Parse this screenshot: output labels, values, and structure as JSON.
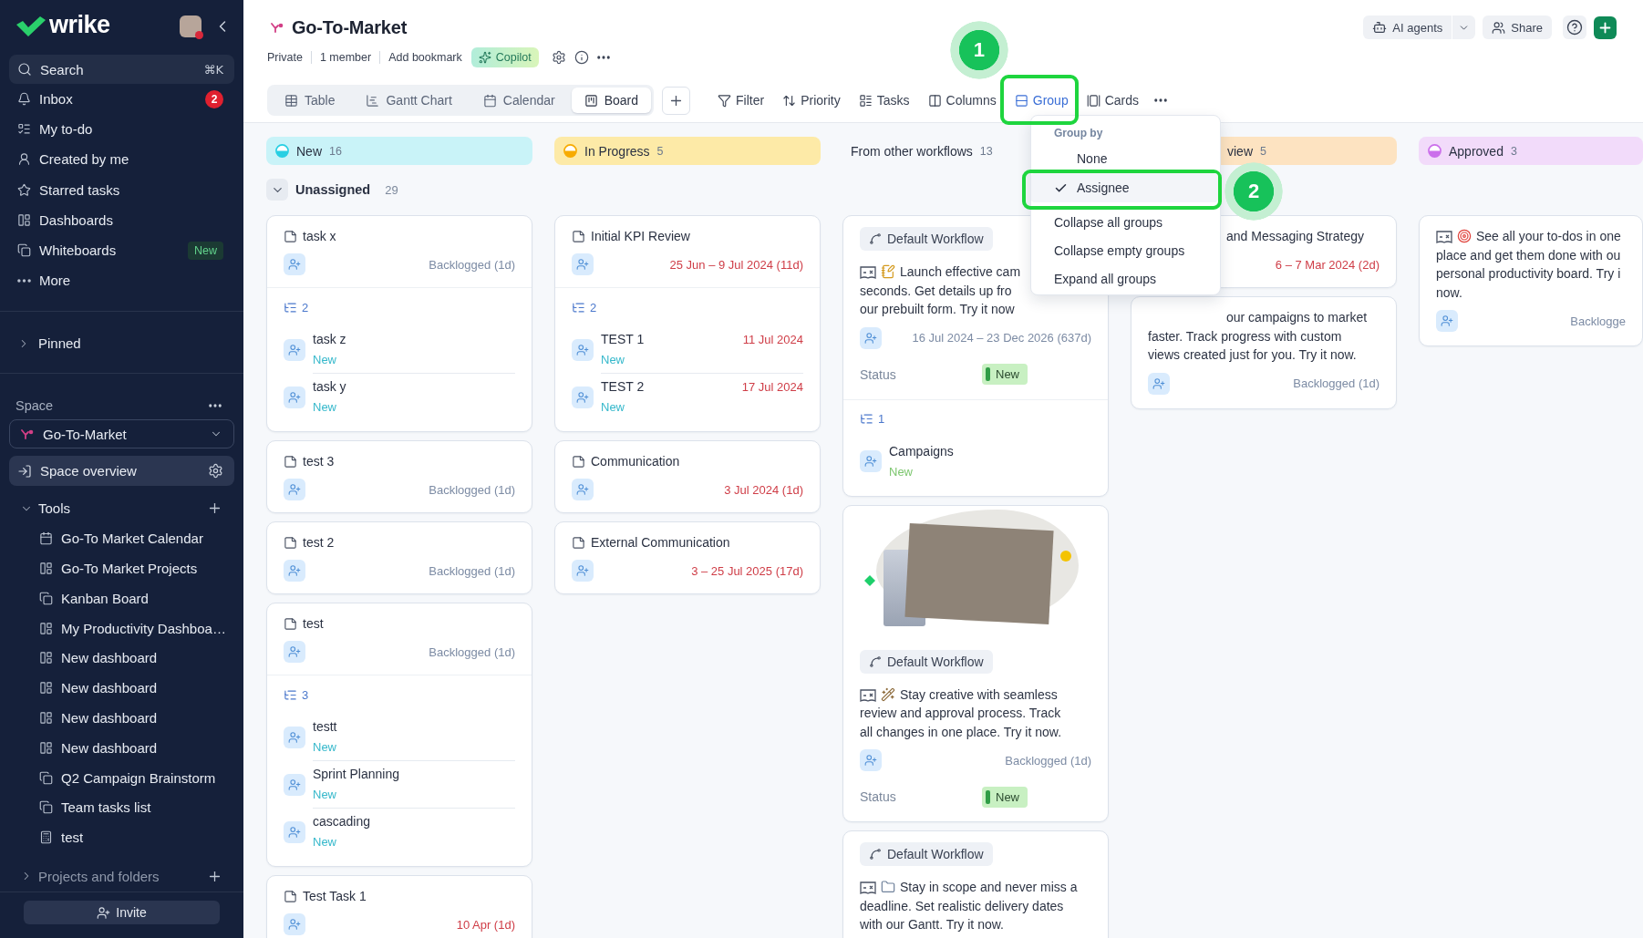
{
  "sidebar": {
    "logo": "wrike",
    "search": {
      "label": "Search",
      "shortcut": "⌘K"
    },
    "nav": [
      {
        "label": "Inbox",
        "kind": "inbox",
        "badge": "2",
        "selected": false
      },
      {
        "label": "My to-do",
        "kind": "todo",
        "selected": false
      },
      {
        "label": "Created by me",
        "kind": "created",
        "selected": false
      },
      {
        "label": "Starred tasks",
        "kind": "starred",
        "selected": false
      },
      {
        "label": "Dashboards",
        "kind": "dashboard",
        "selected": false
      },
      {
        "label": "Whiteboards",
        "kind": "whiteboard",
        "tag": "New",
        "selected": false
      },
      {
        "label": "More",
        "kind": "more",
        "selected": false
      }
    ],
    "pinned": {
      "label": "Pinned",
      "expanded": false
    },
    "space": {
      "label": "Space",
      "selector": "Go-To-Market",
      "overview": {
        "label": "Space overview",
        "selected": true
      }
    },
    "tree": [
      {
        "label": "Tools",
        "expanded": true,
        "children": [
          {
            "label": "Go-To Market Calendar",
            "kind": "calendar",
            "selected": false
          },
          {
            "label": "Go-To Market Projects",
            "kind": "dashboard",
            "selected": false
          },
          {
            "label": "Kanban Board",
            "kind": "whiteboard",
            "selected": false
          },
          {
            "label": "My Productivity Dashboa…",
            "kind": "dashboard",
            "selected": false
          },
          {
            "label": "New dashboard",
            "kind": "dashboard",
            "selected": false
          },
          {
            "label": "New dashboard",
            "kind": "dashboard",
            "selected": false
          },
          {
            "label": "New dashboard",
            "kind": "dashboard",
            "selected": false
          },
          {
            "label": "New dashboard",
            "kind": "dashboard",
            "selected": false
          },
          {
            "label": "Q2 Campaign Brainstorm",
            "kind": "whiteboard",
            "selected": false
          },
          {
            "label": "Team tasks list",
            "kind": "whiteboard",
            "selected": false
          },
          {
            "label": "test",
            "kind": "report",
            "selected": false
          }
        ]
      },
      {
        "label": "Projects and folders",
        "expanded": false
      }
    ],
    "invite": "Invite"
  },
  "header": {
    "title": "Go-To-Market",
    "meta": [
      "Private",
      "1 member",
      "Add bookmark"
    ],
    "copilot": "Copilot",
    "actions": [
      {
        "label": "AI agents",
        "kind": "agents"
      },
      {
        "label": "Share",
        "kind": "share"
      }
    ],
    "views": [
      {
        "label": "Table",
        "kind": "table",
        "selected": false
      },
      {
        "label": "Gantt Chart",
        "kind": "gantt",
        "selected": false
      },
      {
        "label": "Calendar",
        "kind": "calendar",
        "selected": false
      },
      {
        "label": "Board",
        "kind": "board",
        "selected": true
      }
    ],
    "toolbar": [
      {
        "label": "Filter",
        "kind": "filter",
        "active": false
      },
      {
        "label": "Priority",
        "kind": "priority",
        "active": false
      },
      {
        "label": "Tasks",
        "kind": "tasks",
        "active": false
      },
      {
        "label": "Columns",
        "kind": "columns",
        "active": false
      },
      {
        "label": "Group",
        "kind": "group",
        "active": true,
        "annotation": "1"
      },
      {
        "label": "Cards",
        "kind": "cards",
        "active": false
      }
    ]
  },
  "board": {
    "group": {
      "label": "Unassigned",
      "count": "29",
      "expanded": true
    },
    "columns": [
      {
        "label": "New",
        "count": "16",
        "color": "#c9f3f8",
        "cards": [
          {
            "kind": "task",
            "title": "task x",
            "meta": "Backlogged (1d)",
            "overdue": false,
            "subtask_count": "2",
            "subtasks": [
              {
                "name": "task z",
                "status": "New",
                "color": "#35b8cb"
              },
              {
                "name": "task y",
                "status": "New",
                "color": "#35b8cb"
              }
            ]
          },
          {
            "kind": "task",
            "title": "test 3",
            "meta": "Backlogged (1d)",
            "overdue": false
          },
          {
            "kind": "task",
            "title": "test 2",
            "meta": "Backlogged (1d)",
            "overdue": false
          },
          {
            "kind": "task",
            "title": "test",
            "meta": "Backlogged (1d)",
            "overdue": false,
            "subtask_count": "3",
            "subtasks": [
              {
                "name": "testt",
                "status": "New",
                "color": "#35b8cb"
              },
              {
                "name": "Sprint Planning",
                "status": "New",
                "color": "#35b8cb"
              },
              {
                "name": "cascading",
                "status": "New",
                "color": "#35b8cb"
              }
            ]
          },
          {
            "kind": "task",
            "title": "Test Task 1",
            "meta": "10 Apr (1d)",
            "overdue": true
          }
        ]
      },
      {
        "label": "In Progress",
        "count": "5",
        "color": "#fdeaa7",
        "cards": [
          {
            "kind": "task",
            "title": "Initial KPI Review",
            "meta": "25 Jun – 9 Jul 2024 (11d)",
            "overdue": true,
            "subtask_count": "2",
            "subtasks": [
              {
                "name": "TEST 1",
                "status": "New",
                "color": "#35b8cb",
                "date": "11 Jul 2024",
                "overdue": true
              },
              {
                "name": "TEST 2",
                "status": "New",
                "color": "#35b8cb",
                "date": "17 Jul 2024",
                "overdue": true
              }
            ]
          },
          {
            "kind": "task",
            "title": "Communication",
            "meta": "3 Jul 2024 (1d)",
            "overdue": true
          },
          {
            "kind": "task",
            "title": "External Communication",
            "meta": "3 – 25 Jul 2025 (17d)",
            "overdue": true
          }
        ]
      },
      {
        "label": "From other workflows",
        "count": "13",
        "cards": [
          {
            "kind": "template",
            "workflow": "Default Workflow",
            "emoji": {
              "kind": "notepad"
            },
            "text": "Launch effective cam\nseconds. Get details up fro\nour prebuilt form. Try it now",
            "meta": "16 Jul 2024 – 23 Dec 2026 (637d)",
            "overdue": false,
            "status": {
              "label": "Status",
              "value": "New"
            },
            "subtask_count": "1",
            "subtasks": [
              {
                "name": "Campaigns",
                "status": "New",
                "color": "#7cc66e"
              }
            ]
          },
          {
            "kind": "template",
            "image": true,
            "workflow": "Default Workflow",
            "emoji": {
              "kind": "wand"
            },
            "text": "Stay creative with seamless\nreview and approval process. Track\nall changes in one place. Try it now.",
            "meta": "Backlogged (1d)",
            "overdue": false,
            "status": {
              "label": "Status",
              "value": "New"
            }
          },
          {
            "kind": "template",
            "workflow": "Default Workflow",
            "emoji": {
              "kind": "folder"
            },
            "text": "Stay in scope and never miss a\ndeadline. Set realistic delivery dates\nwith our Gantt. Try it now."
          }
        ]
      },
      {
        "label": "view",
        "count": "5",
        "color": "#fde3c1",
        "cards": [
          {
            "kind": "task",
            "title": "and Messaging Strategy",
            "meta": "6 – 7 Mar 2024 (2d)",
            "overdue": true
          },
          {
            "kind": "template",
            "text": "our campaigns to market\nfaster. Track progress with custom\nviews created just for you. Try it now.",
            "meta": "Backlogged (1d)",
            "overdue": false
          }
        ]
      },
      {
        "label": "Approved",
        "count": "3",
        "color": "#f2dbfa",
        "cards": [
          {
            "kind": "template",
            "emoji": {
              "kind": "target"
            },
            "text": "See all your to-dos in one\nplace and get them done with ou\npersonal productivity board. Try i\nnow.",
            "meta": "Backlogge",
            "overdue": false
          }
        ]
      }
    ]
  },
  "group_menu": {
    "heading": "Group by",
    "options": [
      {
        "label": "None",
        "selected": false
      },
      {
        "label": "Assignee",
        "selected": true,
        "annotation": "2"
      }
    ],
    "actions": [
      "Collapse all groups",
      "Collapse empty groups",
      "Expand all groups"
    ]
  }
}
